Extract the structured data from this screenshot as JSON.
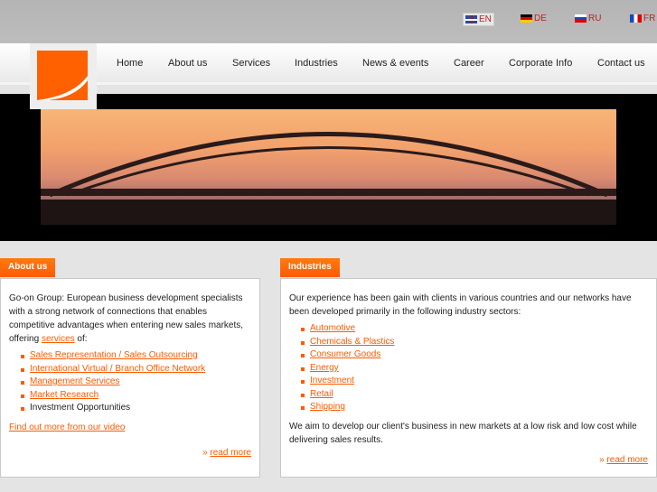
{
  "languages": [
    {
      "code": "EN",
      "active": true
    },
    {
      "code": "DE"
    },
    {
      "code": "RU"
    },
    {
      "code": "FR"
    }
  ],
  "nav": [
    "Home",
    "About us",
    "Services",
    "Industries",
    "News & events",
    "Career",
    "Corporate Info",
    "Contact us"
  ],
  "about": {
    "title": "About us",
    "intro": "Go-on Group: European business development specialists with a strong network of connections that enables competitive advantages when entering new sales markets, offering ",
    "intro_link": "services",
    "intro_end": " of:",
    "items": [
      {
        "label": "Sales Representation / Sales Outsourcing",
        "link": true
      },
      {
        "label": "International Virtual / Branch Office Network",
        "link": true
      },
      {
        "label": "Management Services",
        "link": true
      },
      {
        "label": "Market Research",
        "link": true
      },
      {
        "label": "Investment Opportunities",
        "link": false
      }
    ],
    "video": "Find out more from our video",
    "read_more": "read more",
    "raquo": "»"
  },
  "industries": {
    "title": "Industries",
    "intro": "Our experience has been gain with clients in various countries and our networks have been developed primarily in the following industry sectors:",
    "items": [
      "Automotive",
      "Chemicals & Plastics",
      "Consumer Goods",
      "Energy",
      "Investment",
      "Retail",
      "Shipping"
    ],
    "outro": "We aim to develop our client's business in new markets at a low risk and low cost while delivering sales results.",
    "read_more": "read more",
    "raquo": "»"
  },
  "colors": {
    "accent": "#ff5a00"
  }
}
